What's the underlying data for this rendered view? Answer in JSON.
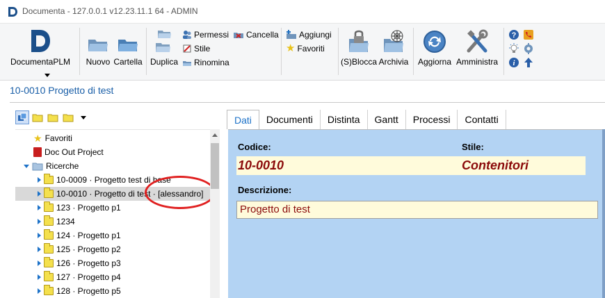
{
  "window": {
    "title": "Documenta - 127.0.0.1 v12.23.11.1 64 - ADMIN"
  },
  "ribbon": {
    "app_label": "DocumentaPLM",
    "nuovo": "Nuovo",
    "cartella": "Cartella",
    "duplica": "Duplica",
    "permessi": "Permessi",
    "stile": "Stile",
    "rinomina": "Rinomina",
    "cancella": "Cancella",
    "aggiungi": "Aggiungi",
    "favoriti": "Favoriti",
    "sblocca": "(S)Blocca",
    "archivia": "Archivia",
    "aggiorna": "Aggiorna",
    "amministra": "Amministra"
  },
  "document": {
    "header": "10-0010 Progetto di test"
  },
  "tree": {
    "items": [
      {
        "label": "Favoriti"
      },
      {
        "label": "Doc Out Project"
      },
      {
        "label": "Ricerche"
      },
      {
        "label": "10-0009 · Progetto test di base"
      },
      {
        "label": "10-0010 · Progetto di test · [alessandro]"
      },
      {
        "label": "123 · Progetto p1"
      },
      {
        "label": "1234"
      },
      {
        "label": "124 · Progetto p1"
      },
      {
        "label": "125 · Progetto p2"
      },
      {
        "label": "126 · Progetto p3"
      },
      {
        "label": "127 · Progetto p4"
      },
      {
        "label": "128 · Progetto p5"
      }
    ]
  },
  "tabs": [
    "Dati",
    "Documenti",
    "Distinta",
    "Gantt",
    "Processi",
    "Contatti"
  ],
  "form": {
    "codice_label": "Codice:",
    "codice_value": "10-0010",
    "stile_label": "Stile:",
    "stile_value": "Contenitori",
    "descrizione_label": "Descrizione:",
    "descrizione_value": "Progetto di test"
  },
  "colors": {
    "accent": "#1d72c8",
    "form_bg": "#b3d3f3",
    "value_bg": "#fffbdb",
    "value_text": "#8b0a0a",
    "highlight_circle": "#e02020"
  }
}
